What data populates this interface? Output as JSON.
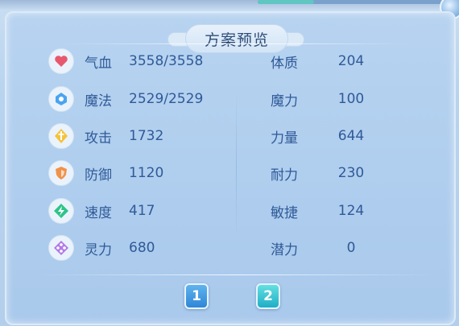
{
  "title": "方案预览",
  "left_stats": [
    {
      "label": "气血",
      "value": "3558/3558",
      "icon": "heart-icon",
      "color": "#e7586e"
    },
    {
      "label": "魔法",
      "value": "2529/2529",
      "icon": "magic-icon",
      "color": "#4aa4f0"
    },
    {
      "label": "攻击",
      "value": "1732",
      "icon": "sword-icon",
      "color": "#f5c33b"
    },
    {
      "label": "防御",
      "value": "1120",
      "icon": "shield-icon",
      "color": "#f0924a"
    },
    {
      "label": "速度",
      "value": "417",
      "icon": "speed-icon",
      "color": "#2fc389"
    },
    {
      "label": "灵力",
      "value": "680",
      "icon": "spirit-icon",
      "color": "#b17ae8"
    }
  ],
  "right_stats": [
    {
      "label": "体质",
      "value": "204"
    },
    {
      "label": "魔力",
      "value": "100"
    },
    {
      "label": "力量",
      "value": "644"
    },
    {
      "label": "耐力",
      "value": "230"
    },
    {
      "label": "敏捷",
      "value": "124"
    },
    {
      "label": "潜力",
      "value": "0"
    }
  ],
  "pages": [
    "1",
    "2"
  ]
}
